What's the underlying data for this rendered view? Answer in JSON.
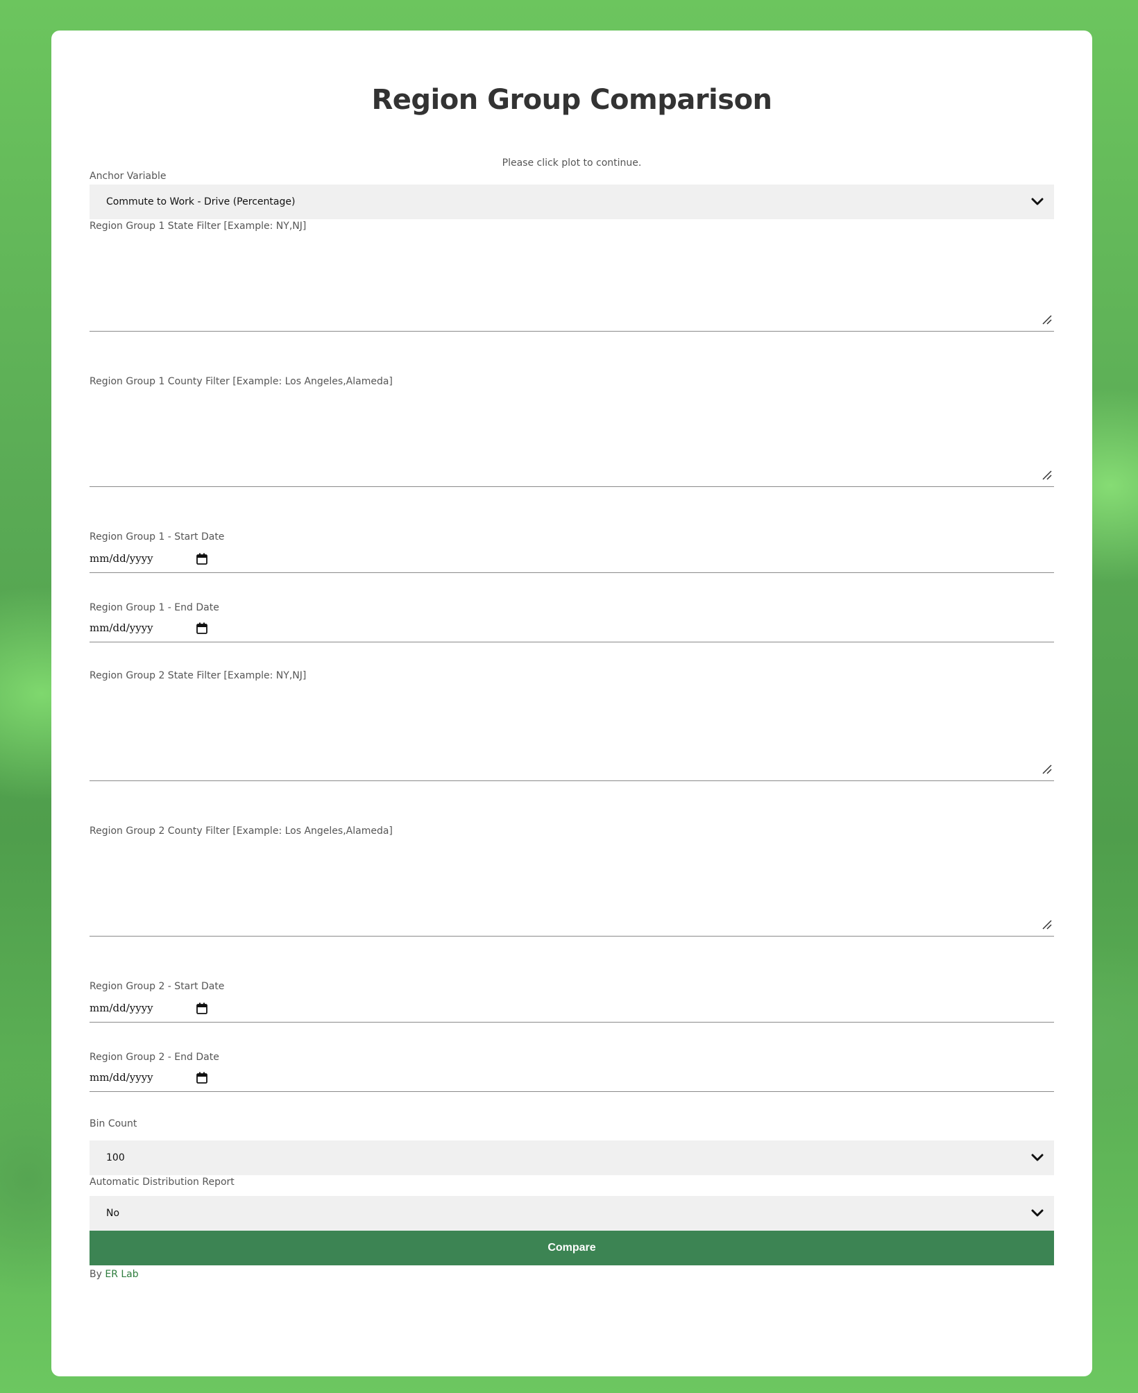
{
  "page": {
    "title": "Region Group Comparison",
    "notice": "Please click plot to continue."
  },
  "form": {
    "anchor_variable": {
      "label": "Anchor Variable",
      "value": "Commute to Work - Drive (Percentage)"
    },
    "group1_state": {
      "label": "Region Group 1 State Filter [Example: NY,NJ]",
      "value": ""
    },
    "group1_county": {
      "label": "Region Group 1 County Filter [Example: Los Angeles,Alameda]",
      "value": ""
    },
    "group1_start": {
      "label": "Region Group 1 - Start Date",
      "placeholder": "mm/dd/yyyy"
    },
    "group1_end": {
      "label": "Region Group 1 - End Date",
      "placeholder": "mm/dd/yyyy"
    },
    "group2_state": {
      "label": "Region Group 2 State Filter [Example: NY,NJ]",
      "value": ""
    },
    "group2_county": {
      "label": "Region Group 2 County Filter [Example: Los Angeles,Alameda]",
      "value": ""
    },
    "group2_start": {
      "label": "Region Group 2 - Start Date",
      "placeholder": "mm/dd/yyyy"
    },
    "group2_end": {
      "label": "Region Group 2 - End Date",
      "placeholder": "mm/dd/yyyy"
    },
    "bin_count": {
      "label": "Bin Count",
      "value": "100"
    },
    "auto_report": {
      "label": "Automatic Distribution Report",
      "value": "No"
    },
    "compare_button": "Compare"
  },
  "footer": {
    "by": "By",
    "link": "ER Lab"
  },
  "colors": {
    "accent": "#3c8453",
    "link": "#2e7d3e",
    "select_bg": "#f0f0f0"
  },
  "icons": {
    "dropdown": "chevron-down-icon",
    "calendar": "calendar-icon",
    "resize": "resize-handle-icon"
  }
}
